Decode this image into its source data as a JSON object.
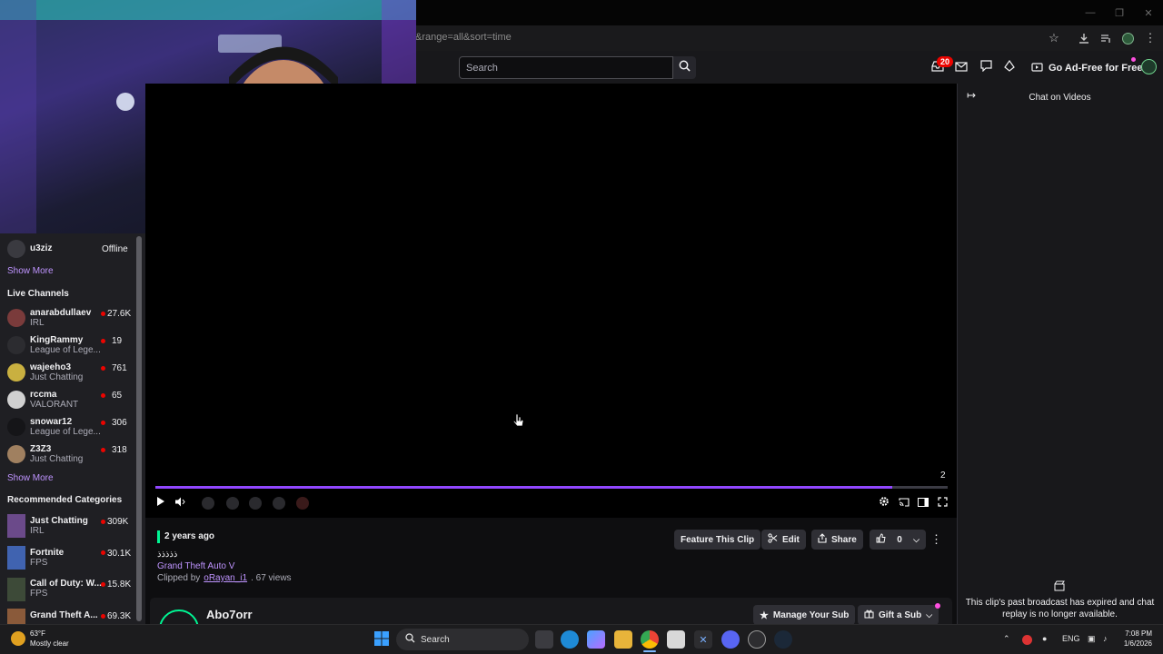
{
  "browser": {
    "url_fragment": "&range=all&sort=time",
    "window_controls": [
      "minimize-icon",
      "restore-icon",
      "close-icon"
    ],
    "icons": [
      "star-icon",
      "download-icon",
      "media-control-icon",
      "profile-icon",
      "menu-icon"
    ]
  },
  "topnav": {
    "search_placeholder": "Search",
    "notifications_count": "20",
    "ad_free_label": "Go Ad-Free for Free"
  },
  "sidebar": {
    "followed": [
      {
        "name": "u3ziz",
        "status": "Offline"
      }
    ],
    "show_more_1": "Show More",
    "live_header": "Live Channels",
    "live": [
      {
        "name": "anarabdullaev",
        "category": "IRL",
        "viewers": "27.6K"
      },
      {
        "name": "KingRammy",
        "category": "League of Lege...",
        "viewers": "19"
      },
      {
        "name": "wajeeho3",
        "category": "Just Chatting",
        "viewers": "761"
      },
      {
        "name": "rccma",
        "category": "VALORANT",
        "viewers": "65"
      },
      {
        "name": "snowar12",
        "category": "League of Lege...",
        "viewers": "306"
      },
      {
        "name": "Z3Z3",
        "category": "Just Chatting",
        "viewers": "318"
      }
    ],
    "show_more_2": "Show More",
    "rec_header": "Recommended Categories",
    "recommended": [
      {
        "name": "Just Chatting",
        "tag": "IRL",
        "viewers": "309K"
      },
      {
        "name": "Fortnite",
        "tag": "FPS",
        "viewers": "30.1K"
      },
      {
        "name": "Call of Duty: W...",
        "tag": "FPS",
        "viewers": "15.8K"
      },
      {
        "name": "Grand Theft A...",
        "tag": "FPS",
        "viewers": "69.3K"
      }
    ]
  },
  "player": {
    "time_label": "2",
    "progress": 0.93
  },
  "clip": {
    "age": "2 years ago",
    "title": "ذذذذذ",
    "game": "Grand Theft Auto V",
    "clipped_by_prefix": "Clipped by",
    "clipper": "oRayan_i1",
    "views": ". 67 views",
    "feature_label": "Feature This Clip",
    "edit_label": "Edit",
    "share_label": "Share",
    "likes": "0"
  },
  "channel": {
    "name": "Abo7orr",
    "manage_sub_label": "Manage Your Sub",
    "gift_sub_label": "Gift a Sub"
  },
  "chat": {
    "title": "Chat on Videos",
    "expired_message": "This clip's past broadcast has expired and chat replay is no longer available."
  },
  "taskbar": {
    "weather_temp": "63°F",
    "weather_desc": "Mostly clear",
    "search_label": "Search",
    "lang": "ENG",
    "time": "7:08 PM",
    "date": "1/6/2026"
  },
  "colors": {
    "accent": "#9147ff",
    "link": "#bf94ff",
    "live": "#eb0400",
    "clip_accent": "#00f593"
  }
}
